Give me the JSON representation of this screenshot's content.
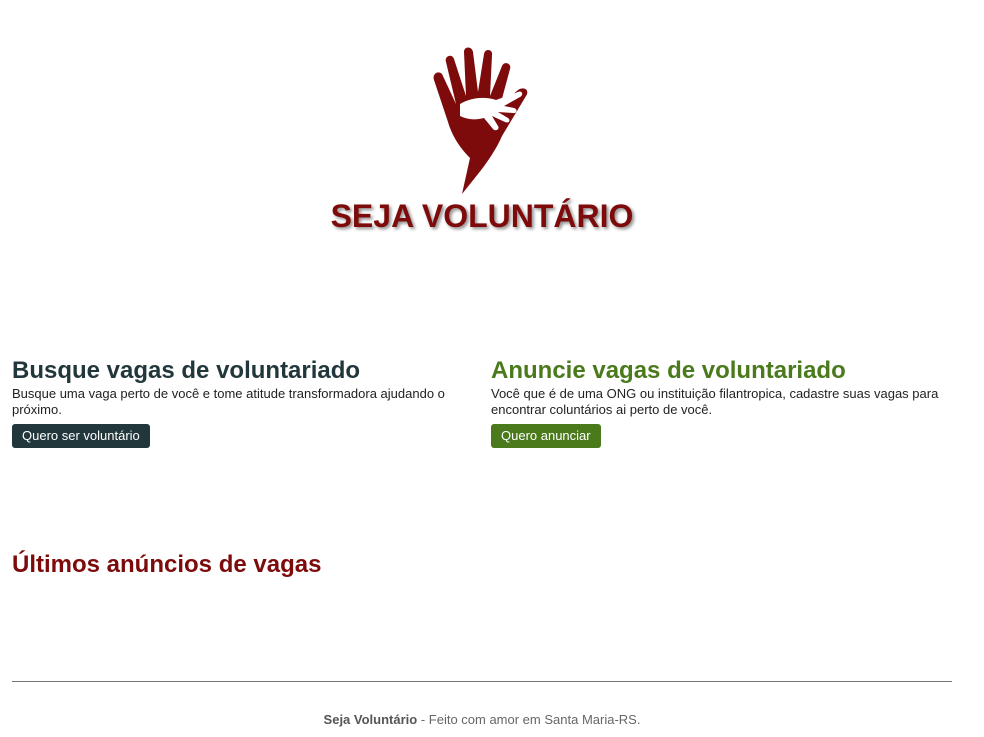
{
  "brand": {
    "title": "SEJA VOLUNTÁRIO",
    "logo_icon": "hand-helping-hand-icon",
    "color": "#7d0b0b"
  },
  "search_section": {
    "heading": "Busque vagas de voluntariado",
    "description": "Busque uma vaga perto de você e tome atitude transformadora ajudando o próximo.",
    "button_label": "Quero ser voluntário",
    "color": "#22373c"
  },
  "announce_section": {
    "heading": "Anuncie vagas de voluntariado",
    "description": "Você que é de uma ONG ou instituição filantropica, cadastre suas vagas para encontrar coluntários ai perto de você.",
    "button_label": "Quero anunciar",
    "color": "#4a7a1c"
  },
  "latest": {
    "heading": "Últimos anúncios de vagas"
  },
  "footer": {
    "brand": "Seja Voluntário",
    "text": " - Feito com amor em Santa Maria-RS."
  }
}
